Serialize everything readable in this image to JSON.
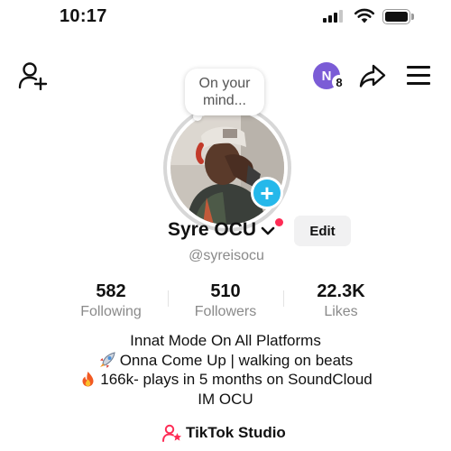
{
  "status_bar": {
    "time": "10:17"
  },
  "toolbar": {
    "notification_initial": "N",
    "notification_count": "8"
  },
  "note_bubble": {
    "line1": "On your",
    "line2": "mind..."
  },
  "profile": {
    "display_name": "Syre OCU",
    "username": "@syreisocu",
    "edit_label": "Edit",
    "add_story_symbol": "+"
  },
  "stats": {
    "following": {
      "value": "582",
      "label": "Following"
    },
    "followers": {
      "value": "510",
      "label": "Followers"
    },
    "likes": {
      "value": "22.3K",
      "label": "Likes"
    }
  },
  "bio": {
    "line1": "Innat Mode On All Platforms",
    "line2": "Onna Come Up | walking on beats",
    "line3": "166k- plays in 5 months on SoundCloud",
    "line4": "IM OCU"
  },
  "studio": {
    "label": "TikTok Studio"
  },
  "colors": {
    "accent_red": "#fe2c55",
    "story_blue": "#25b8ea",
    "notif_purple": "#7b5cd6"
  }
}
